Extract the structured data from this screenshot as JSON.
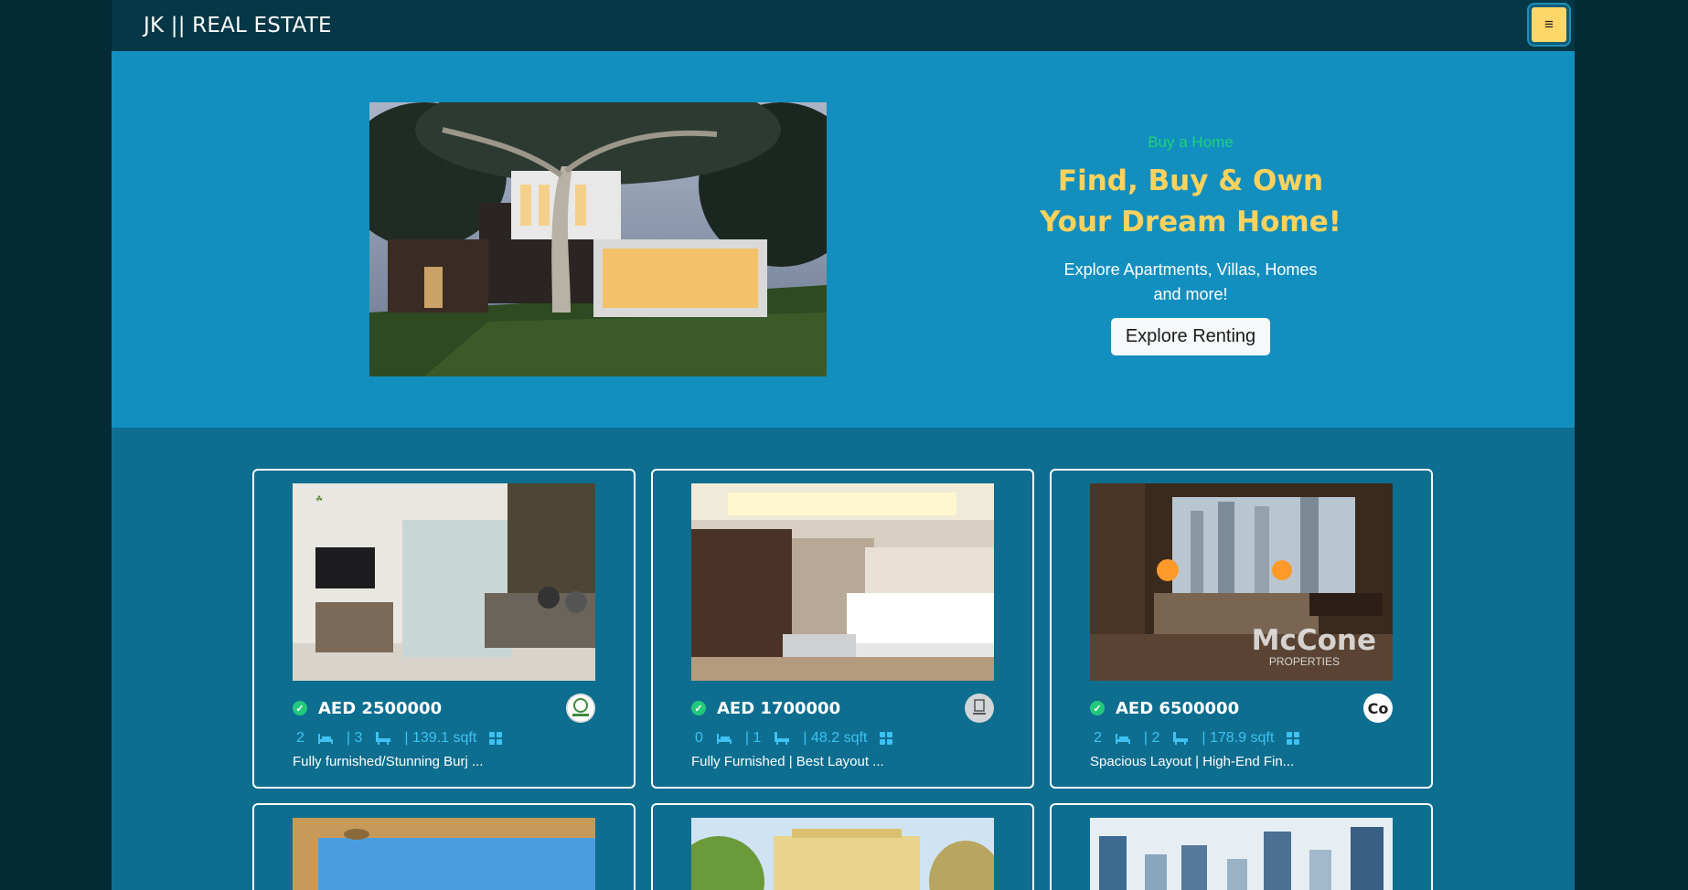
{
  "nav": {
    "brand": "JK || REAL ESTATE",
    "menu_glyph": "≡"
  },
  "hero": {
    "eyebrow": "Buy a Home",
    "headline": "Find, Buy & Own Your Dream Home!",
    "subtitle": "Explore Apartments, Villas, Homes and more!",
    "cta": "Explore Renting"
  },
  "listings": [
    {
      "price": "AED 2500000",
      "rooms": "2",
      "baths": "| 3",
      "area": "| 139.1 sqft",
      "title": "Fully furnished/Stunning Burj ...",
      "agency_text": "",
      "watermark": ""
    },
    {
      "price": "AED 1700000",
      "rooms": "0",
      "baths": "| 1",
      "area": "| 48.2 sqft",
      "title": "Fully Furnished | Best Layout ...",
      "agency_text": "",
      "watermark": ""
    },
    {
      "price": "AED 6500000",
      "rooms": "2",
      "baths": "| 2",
      "area": "| 178.9 sqft",
      "title": "Spacious Layout | High-End Fin...",
      "agency_text": "Co",
      "watermark": "McCone",
      "watermark_sub": "PROPERTIES"
    }
  ],
  "colors": {
    "page_bg": "#042a35",
    "nav_bg": "#053746",
    "hero_bg": "#128fbf",
    "listing_bg": "#0e6e8f",
    "accent_yellow": "#ffd25d",
    "accent_green": "#1fd17b",
    "meta_blue": "#3ec2f2"
  }
}
